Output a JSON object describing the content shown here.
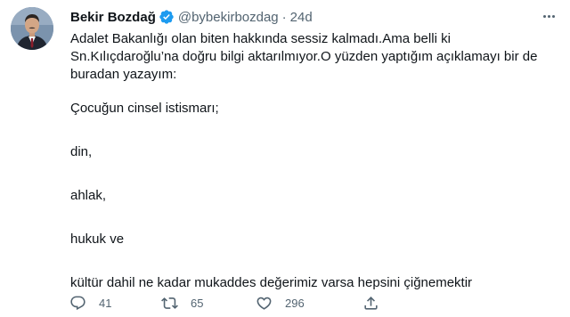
{
  "tweet": {
    "author": {
      "display_name": "Bekir Bozdağ",
      "handle": "@bybekirbozdag",
      "verified": true
    },
    "separator": "·",
    "timestamp": "24d",
    "paragraphs": [
      "Adalet Bakanlığı olan biten hakkında sessiz kalmadı.Ama belli ki Sn.Kılıçdaroğlu’na doğru bilgi aktarılmıyor.O yüzden yaptığım açıklamayı bir de buradan yazayım:",
      "Çocuğun cinsel istismarı;",
      "din,",
      "ahlak,",
      "hukuk ve",
      "kültür dahil ne kadar mukaddes değerimiz varsa hepsini çiğnemektir"
    ],
    "actions": {
      "replies": "41",
      "retweets": "65",
      "likes": "296"
    }
  },
  "colors": {
    "text": "#0f1419",
    "secondary": "#536471",
    "verified": "#1d9bf0"
  },
  "icons": {
    "verified": "verified-badge-icon",
    "more": "more-icon",
    "reply": "reply-icon",
    "retweet": "retweet-icon",
    "like": "heart-icon",
    "share": "share-icon"
  }
}
